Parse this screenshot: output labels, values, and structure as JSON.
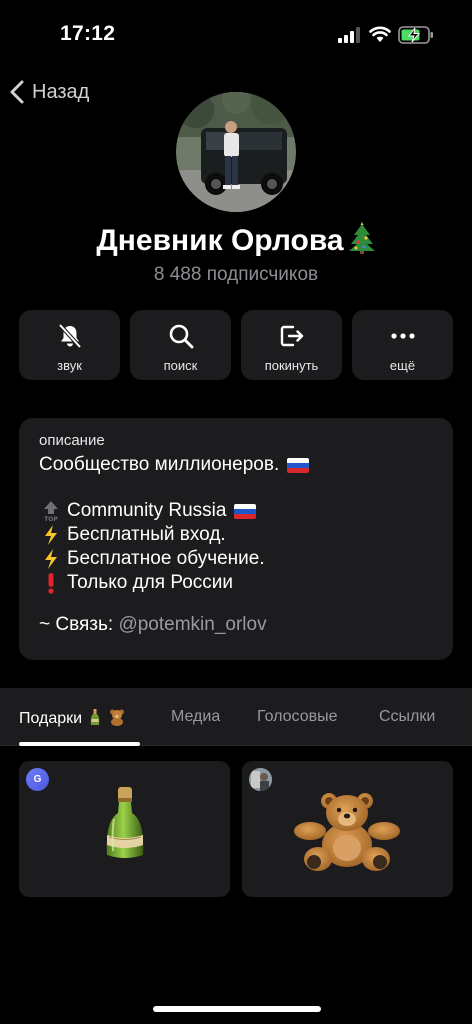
{
  "status_bar": {
    "time": "17:12"
  },
  "nav": {
    "back_label": "Назад"
  },
  "channel": {
    "title": "Дневник Орлова",
    "title_emoji": "christmas-tree",
    "subscribers": "8 488 подписчиков"
  },
  "actions": [
    {
      "label": "звук",
      "icon": "bell-muted-icon"
    },
    {
      "label": "поиск",
      "icon": "search-icon"
    },
    {
      "label": "покинуть",
      "icon": "leave-icon"
    },
    {
      "label": "ещё",
      "icon": "more-icon"
    }
  ],
  "description": {
    "caption": "описание",
    "line1": "Сообщество миллионеров.",
    "line2": "Community Russia",
    "line3": "Бесплатный вход.",
    "line4": "Бесплатное обучение.",
    "line5": "Только для России",
    "contact_prefix": "~ Связь: ",
    "contact_handle": "@potemkin_orlov"
  },
  "tabs": [
    {
      "label": "Подарки",
      "active": true
    },
    {
      "label": "Медиа",
      "active": false
    },
    {
      "label": "Голосовые",
      "active": false
    },
    {
      "label": "Ссылки",
      "active": false
    }
  ],
  "gifts": [
    {
      "sender_initial": "G",
      "item": "champagne-bottle"
    },
    {
      "sender_initial": "",
      "item": "teddy-bear"
    }
  ],
  "colors": {
    "background": "#000000",
    "card": "#1c1c1e",
    "secondary_text": "#8d8d93",
    "battery_green": "#4cd964",
    "sender_avatar": "#5e6cf0"
  }
}
